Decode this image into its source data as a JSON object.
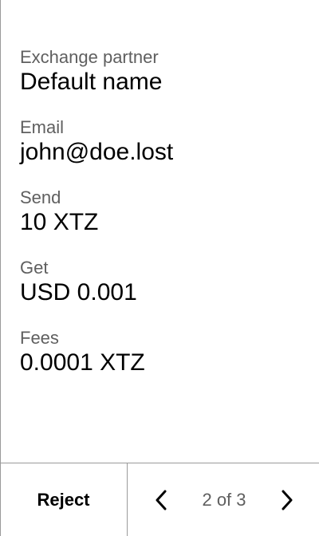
{
  "fields": [
    {
      "label": "Exchange partner",
      "value": "Default name"
    },
    {
      "label": "Email",
      "value": "john@doe.lost"
    },
    {
      "label": "Send",
      "value": "10 XTZ"
    },
    {
      "label": "Get",
      "value": "USD 0.001"
    },
    {
      "label": "Fees",
      "value": "0.0001 XTZ"
    }
  ],
  "footer": {
    "reject_label": "Reject",
    "page_indicator": "2 of 3",
    "prev_icon": "chevron-left-icon",
    "next_icon": "chevron-right-icon"
  },
  "colors": {
    "label": "#5f5f5f",
    "value": "#000000",
    "divider": "#9a9a9a",
    "background": "#ffffff"
  }
}
